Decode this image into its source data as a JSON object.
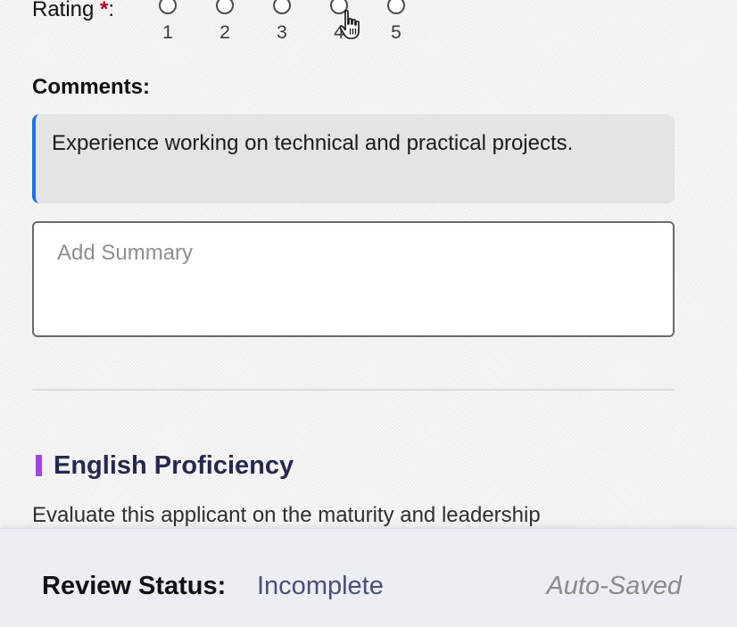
{
  "rating": {
    "label": "Rating",
    "required_mark": "*",
    "colon": ":",
    "options": [
      "1",
      "2",
      "3",
      "4",
      "5"
    ]
  },
  "comments": {
    "label": "Comments:",
    "text": "Experience working on technical and practical projects."
  },
  "summary": {
    "placeholder": "Add Summary",
    "value": ""
  },
  "section": {
    "title": "English Proficiency",
    "description": "Evaluate this applicant on the maturity and leadership",
    "accent_color": "#a443e8"
  },
  "footer": {
    "status_label": "Review Status:",
    "status_value": "Incomplete",
    "save_status": "Auto-Saved"
  },
  "colors": {
    "comment_accent": "#1a73e8",
    "required_star": "#b0002a",
    "status_value": "#4a4e78"
  },
  "icons": {
    "cursor": "hand-pointer-icon"
  }
}
